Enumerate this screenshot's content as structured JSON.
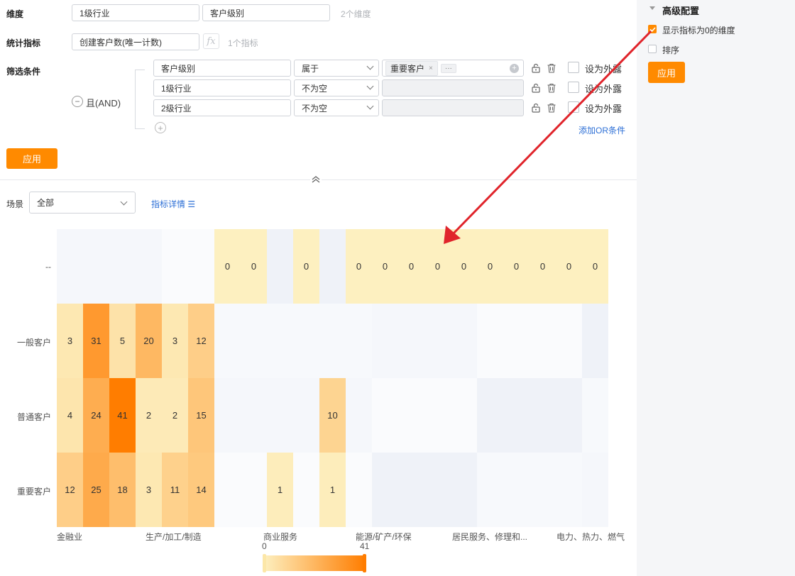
{
  "form": {
    "dim_label": "维度",
    "dims": [
      "1级行业",
      "客户级别"
    ],
    "dim_count": "2个维度",
    "metric_label": "统计指标",
    "metric_value": "创建客户数(唯一计数)",
    "fx": "fx",
    "metric_count": "1个指标",
    "filter_label": "筛选条件",
    "and_label": "且(AND)",
    "filters": [
      {
        "field": "客户级别",
        "op": "属于",
        "tag": "重要客户",
        "more": "···",
        "expose": "设为外露"
      },
      {
        "field": "1级行业",
        "op": "不为空",
        "expose": "设为外露"
      },
      {
        "field": "2级行业",
        "op": "不为空",
        "expose": "设为外露"
      }
    ],
    "add_or": "添加OR条件",
    "apply": "应用"
  },
  "toolbar": {
    "scene_label": "场景",
    "scene_value": "全部",
    "metric_detail": "指标详情"
  },
  "side": {
    "title": "高级配置",
    "opt1": "显示指标为0的维度",
    "opt1_checked": true,
    "opt2": "排序",
    "opt2_checked": false,
    "apply": "应用"
  },
  "colors": {
    "accent": "#ff8a00",
    "link": "#2d6fd6",
    "arrow": "#e0242b"
  },
  "chart_data": {
    "type": "heatmap",
    "rows": [
      "--",
      "一般客户",
      "普通客户",
      "重要客户"
    ],
    "x_labels_shown": [
      "金融业",
      "生产/加工/制造",
      "商业服务",
      "能源/矿产/环保",
      "居民服务、修理和...",
      "电力、热力、燃气"
    ],
    "values": [
      [
        null,
        null,
        null,
        null,
        null,
        null,
        0,
        0,
        null,
        0,
        null,
        0,
        0,
        0,
        0,
        0,
        0,
        0,
        0,
        0,
        0
      ],
      [
        3,
        31,
        5,
        20,
        3,
        12,
        null,
        null,
        null,
        null,
        null,
        null,
        null,
        null,
        null,
        null,
        null,
        null,
        null,
        null,
        null
      ],
      [
        4,
        24,
        41,
        2,
        2,
        15,
        null,
        null,
        null,
        null,
        10,
        null,
        null,
        null,
        null,
        null,
        null,
        null,
        null,
        null,
        null
      ],
      [
        12,
        25,
        18,
        3,
        11,
        14,
        null,
        null,
        1,
        null,
        1,
        null,
        null,
        null,
        null,
        null,
        null,
        null,
        null,
        null,
        null
      ]
    ],
    "scale_min": "0",
    "scale_max": "41",
    "color_min": "#fdf0c0",
    "color_max": "#ff7d00"
  }
}
